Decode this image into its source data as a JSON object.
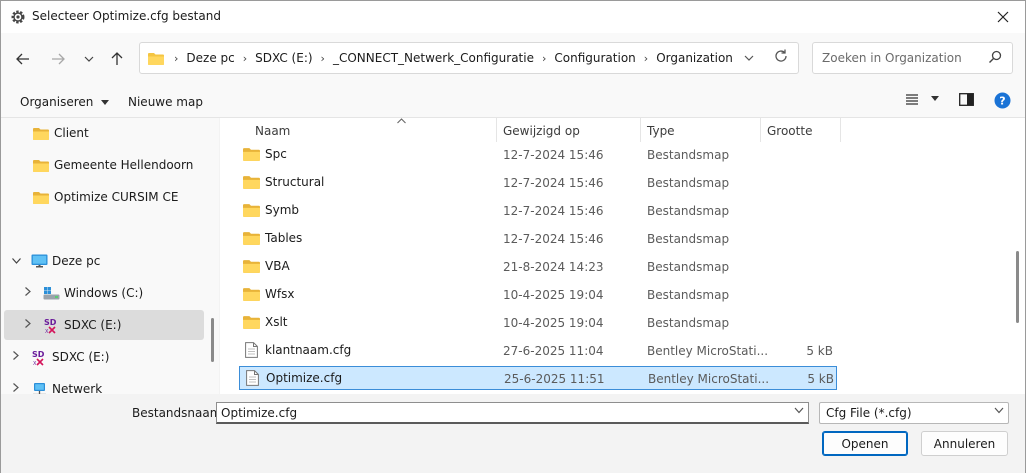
{
  "window": {
    "title": "Selecteer Optimize.cfg bestand"
  },
  "address": {
    "crumbs": [
      "Deze pc",
      "SDXC (E:)",
      "_CONNECT_Netwerk_Configuratie",
      "Configuration",
      "Organization"
    ]
  },
  "search": {
    "placeholder": "Zoeken in Organization"
  },
  "toolbar": {
    "organize_label": "Organiseren",
    "new_folder_label": "Nieuwe map"
  },
  "sidebar": {
    "items": [
      {
        "label": "Client",
        "icon": "folder-icon"
      },
      {
        "label": "Gemeente Hellendoorn",
        "icon": "folder-icon"
      },
      {
        "label": "Optimize CURSIM CE",
        "icon": "folder-icon"
      },
      {
        "label": "Deze pc",
        "icon": "computer-icon"
      },
      {
        "label": "Windows (C:)",
        "icon": "drive-icon"
      },
      {
        "label": "SDXC (E:)",
        "icon": "sd-card-icon"
      },
      {
        "label": "SDXC (E:)",
        "icon": "sd-card-icon"
      },
      {
        "label": "Netwerk",
        "icon": "network-icon"
      }
    ]
  },
  "columns": {
    "name": "Naam",
    "modified": "Gewijzigd op",
    "type": "Type",
    "size": "Grootte"
  },
  "files": [
    {
      "name": "Spc",
      "modified": "12-7-2024 15:46",
      "type": "Bestandsmap",
      "size": ""
    },
    {
      "name": "Structural",
      "modified": "12-7-2024 15:46",
      "type": "Bestandsmap",
      "size": ""
    },
    {
      "name": "Symb",
      "modified": "12-7-2024 15:46",
      "type": "Bestandsmap",
      "size": ""
    },
    {
      "name": "Tables",
      "modified": "12-7-2024 15:46",
      "type": "Bestandsmap",
      "size": ""
    },
    {
      "name": "VBA",
      "modified": "21-8-2024 14:23",
      "type": "Bestandsmap",
      "size": ""
    },
    {
      "name": "Wfsx",
      "modified": "10-4-2025 19:04",
      "type": "Bestandsmap",
      "size": ""
    },
    {
      "name": "Xslt",
      "modified": "10-4-2025 19:04",
      "type": "Bestandsmap",
      "size": ""
    },
    {
      "name": "klantnaam.cfg",
      "modified": "27-6-2025 11:04",
      "type": "Bentley MicroStati...",
      "size": "5 kB"
    },
    {
      "name": "Optimize.cfg",
      "modified": "25-6-2025 11:51",
      "type": "Bentley MicroStati...",
      "size": "5 kB"
    }
  ],
  "bottom": {
    "filename_label": "Bestandsnaam:",
    "filename_value": "Optimize.cfg",
    "filter_value": "Cfg File (*.cfg)",
    "open_label": "Openen",
    "cancel_label": "Annuleren"
  },
  "colors": {
    "selection": "#cce8ff",
    "selection_border": "#3b8dd8",
    "accent": "#0067c0",
    "folder": "#f4c542"
  }
}
